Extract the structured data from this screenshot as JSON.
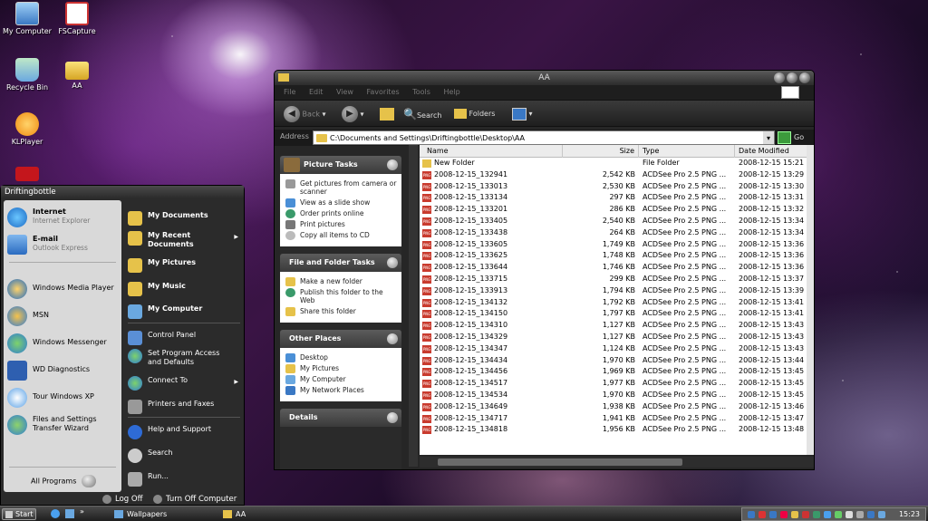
{
  "desktop_icons": [
    {
      "label": "My Computer",
      "icon": "my-computer-icon"
    },
    {
      "label": "FSCapture",
      "icon": "fscapture-icon"
    },
    {
      "label": "Recycle Bin",
      "icon": "recycle-bin-icon"
    },
    {
      "label": "AA",
      "icon": "folder-icon"
    },
    {
      "label": "KLPlayer",
      "icon": "klplayer-icon"
    }
  ],
  "window": {
    "title": "AA",
    "menu": [
      "File",
      "Edit",
      "View",
      "Favorites",
      "Tools",
      "Help"
    ],
    "toolbar": {
      "back": "Back",
      "search": "Search",
      "folders": "Folders"
    },
    "address": {
      "label": "Address",
      "value": "C:\\Documents and Settings\\Driftingbottle\\Desktop\\AA",
      "go": "Go"
    },
    "panels": {
      "picture_tasks": {
        "title": "Picture Tasks",
        "items": [
          "Get pictures from camera or scanner",
          "View as a slide show",
          "Order prints online",
          "Print pictures",
          "Copy all items to CD"
        ]
      },
      "file_tasks": {
        "title": "File and Folder Tasks",
        "items": [
          "Make a new folder",
          "Publish this folder to the Web",
          "Share this folder"
        ]
      },
      "other_places": {
        "title": "Other Places",
        "items": [
          "Desktop",
          "My Pictures",
          "My Computer",
          "My Network Places"
        ]
      },
      "details": {
        "title": "Details"
      }
    },
    "columns": {
      "name": "Name",
      "size": "Size",
      "type": "Type",
      "date": "Date Modified"
    },
    "files": [
      {
        "name": "New Folder",
        "size": "",
        "type": "File Folder",
        "date": "2008-12-15 15:21",
        "kind": "folder"
      },
      {
        "name": "2008-12-15_132941",
        "size": "2,542 KB",
        "type": "ACDSee Pro 2.5 PNG ...",
        "date": "2008-12-15 13:29",
        "kind": "png"
      },
      {
        "name": "2008-12-15_133013",
        "size": "2,530 KB",
        "type": "ACDSee Pro 2.5 PNG ...",
        "date": "2008-12-15 13:30",
        "kind": "png"
      },
      {
        "name": "2008-12-15_133134",
        "size": "297 KB",
        "type": "ACDSee Pro 2.5 PNG ...",
        "date": "2008-12-15 13:31",
        "kind": "png"
      },
      {
        "name": "2008-12-15_133201",
        "size": "286 KB",
        "type": "ACDSee Pro 2.5 PNG ...",
        "date": "2008-12-15 13:32",
        "kind": "png"
      },
      {
        "name": "2008-12-15_133405",
        "size": "2,540 KB",
        "type": "ACDSee Pro 2.5 PNG ...",
        "date": "2008-12-15 13:34",
        "kind": "png"
      },
      {
        "name": "2008-12-15_133438",
        "size": "264 KB",
        "type": "ACDSee Pro 2.5 PNG ...",
        "date": "2008-12-15 13:34",
        "kind": "png"
      },
      {
        "name": "2008-12-15_133605",
        "size": "1,749 KB",
        "type": "ACDSee Pro 2.5 PNG ...",
        "date": "2008-12-15 13:36",
        "kind": "png"
      },
      {
        "name": "2008-12-15_133625",
        "size": "1,748 KB",
        "type": "ACDSee Pro 2.5 PNG ...",
        "date": "2008-12-15 13:36",
        "kind": "png"
      },
      {
        "name": "2008-12-15_133644",
        "size": "1,746 KB",
        "type": "ACDSee Pro 2.5 PNG ...",
        "date": "2008-12-15 13:36",
        "kind": "png"
      },
      {
        "name": "2008-12-15_133715",
        "size": "299 KB",
        "type": "ACDSee Pro 2.5 PNG ...",
        "date": "2008-12-15 13:37",
        "kind": "png"
      },
      {
        "name": "2008-12-15_133913",
        "size": "1,794 KB",
        "type": "ACDSee Pro 2.5 PNG ...",
        "date": "2008-12-15 13:39",
        "kind": "png"
      },
      {
        "name": "2008-12-15_134132",
        "size": "1,792 KB",
        "type": "ACDSee Pro 2.5 PNG ...",
        "date": "2008-12-15 13:41",
        "kind": "png"
      },
      {
        "name": "2008-12-15_134150",
        "size": "1,797 KB",
        "type": "ACDSee Pro 2.5 PNG ...",
        "date": "2008-12-15 13:41",
        "kind": "png"
      },
      {
        "name": "2008-12-15_134310",
        "size": "1,127 KB",
        "type": "ACDSee Pro 2.5 PNG ...",
        "date": "2008-12-15 13:43",
        "kind": "png"
      },
      {
        "name": "2008-12-15_134329",
        "size": "1,127 KB",
        "type": "ACDSee Pro 2.5 PNG ...",
        "date": "2008-12-15 13:43",
        "kind": "png"
      },
      {
        "name": "2008-12-15_134347",
        "size": "1,124 KB",
        "type": "ACDSee Pro 2.5 PNG ...",
        "date": "2008-12-15 13:43",
        "kind": "png"
      },
      {
        "name": "2008-12-15_134434",
        "size": "1,970 KB",
        "type": "ACDSee Pro 2.5 PNG ...",
        "date": "2008-12-15 13:44",
        "kind": "png"
      },
      {
        "name": "2008-12-15_134456",
        "size": "1,969 KB",
        "type": "ACDSee Pro 2.5 PNG ...",
        "date": "2008-12-15 13:45",
        "kind": "png"
      },
      {
        "name": "2008-12-15_134517",
        "size": "1,977 KB",
        "type": "ACDSee Pro 2.5 PNG ...",
        "date": "2008-12-15 13:45",
        "kind": "png"
      },
      {
        "name": "2008-12-15_134534",
        "size": "1,970 KB",
        "type": "ACDSee Pro 2.5 PNG ...",
        "date": "2008-12-15 13:45",
        "kind": "png"
      },
      {
        "name": "2008-12-15_134649",
        "size": "1,938 KB",
        "type": "ACDSee Pro 2.5 PNG ...",
        "date": "2008-12-15 13:46",
        "kind": "png"
      },
      {
        "name": "2008-12-15_134717",
        "size": "1,941 KB",
        "type": "ACDSee Pro 2.5 PNG ...",
        "date": "2008-12-15 13:47",
        "kind": "png"
      },
      {
        "name": "2008-12-15_134818",
        "size": "1,956 KB",
        "type": "ACDSee Pro 2.5 PNG ...",
        "date": "2008-12-15 13:48",
        "kind": "png"
      }
    ]
  },
  "start_menu": {
    "user": "Driftingbottle",
    "pinned": [
      {
        "title": "Internet",
        "sub": "Internet Explorer"
      },
      {
        "title": "E-mail",
        "sub": "Outlook Express"
      }
    ],
    "recent": [
      "Windows Media Player",
      "MSN",
      "Windows Messenger",
      "WD Diagnostics",
      "Tour Windows XP",
      "Files and Settings Transfer Wizard"
    ],
    "all_programs": "All Programs",
    "right": [
      "My Documents",
      "My Recent Documents",
      "My Pictures",
      "My Music",
      "My Computer",
      "Control Panel",
      "Set Program Access and Defaults",
      "Connect To",
      "Printers and Faxes",
      "Help and Support",
      "Search",
      "Run..."
    ],
    "log_off": "Log Off",
    "turn_off": "Turn Off Computer"
  },
  "taskbar": {
    "start": "Start",
    "items": [
      "Wallpapers",
      "AA"
    ],
    "clock": "15:23"
  }
}
